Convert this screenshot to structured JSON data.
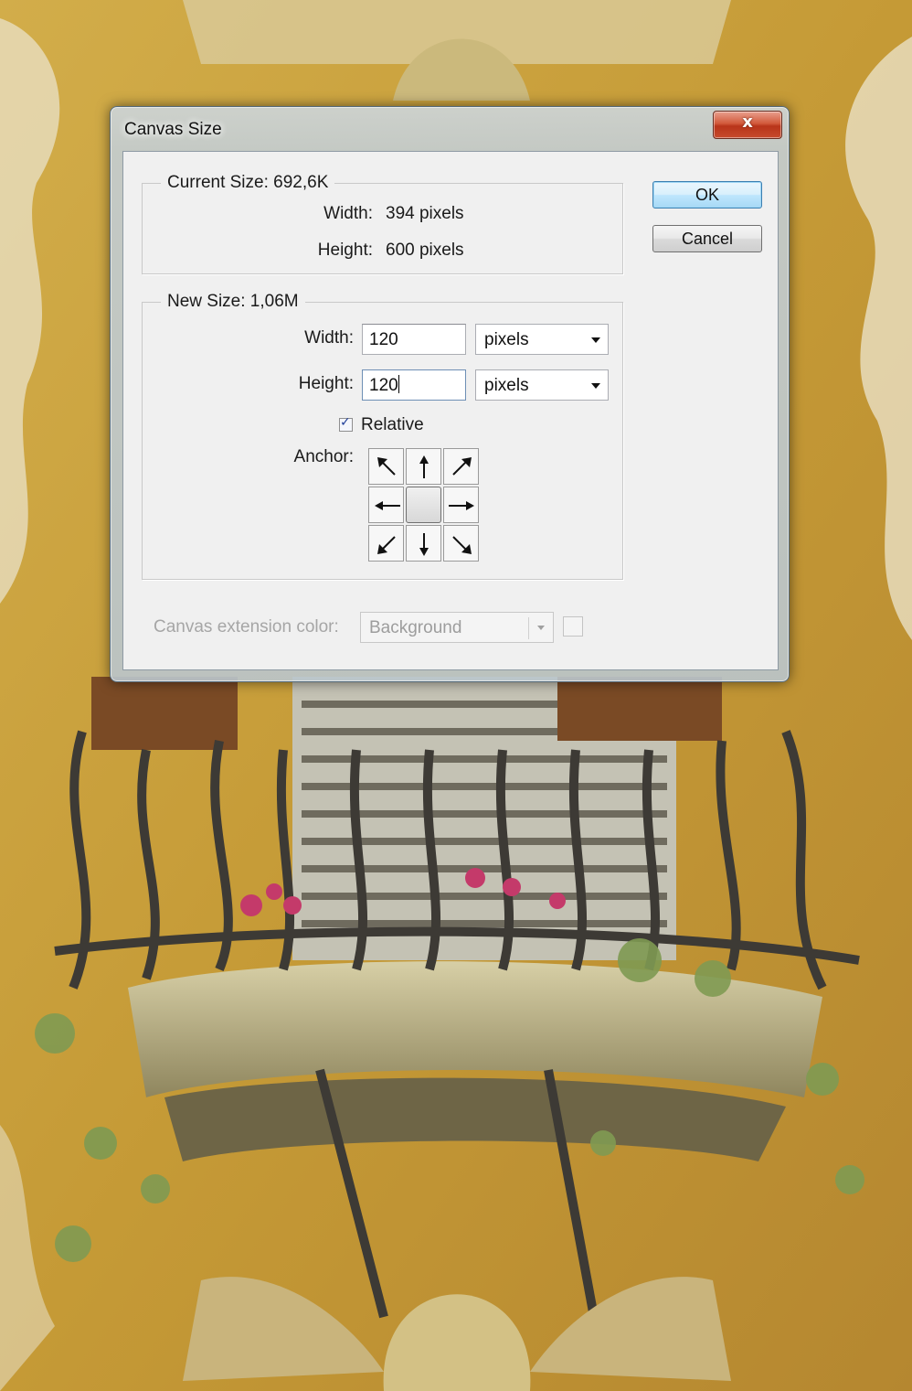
{
  "window": {
    "title": "Canvas Size",
    "close_glyph": "x"
  },
  "current_size": {
    "legend": "Current Size: 692,6K",
    "width_label": "Width:",
    "width_value": "394 pixels",
    "height_label": "Height:",
    "height_value": "600 pixels"
  },
  "new_size": {
    "legend": "New Size: 1,06M",
    "width_label": "Width:",
    "width_value": "120",
    "width_unit": "pixels",
    "height_label": "Height:",
    "height_value": "120",
    "height_unit": "pixels",
    "relative_label": "Relative",
    "relative_checked": true,
    "anchor_label": "Anchor:",
    "anchor_selected": "center"
  },
  "buttons": {
    "ok": "OK",
    "cancel": "Cancel"
  },
  "extension": {
    "label": "Canvas extension color:",
    "value": "Background"
  },
  "colors": {
    "default_button": "#bee6fd",
    "close_button": "#c74b2c"
  },
  "icons": [
    "close-icon",
    "dropdown-arrow-icon",
    "checkmark-icon",
    "arrow-nw-icon",
    "arrow-n-icon",
    "arrow-ne-icon",
    "arrow-w-icon",
    "arrow-e-icon",
    "arrow-sw-icon",
    "arrow-s-icon",
    "arrow-se-icon"
  ]
}
